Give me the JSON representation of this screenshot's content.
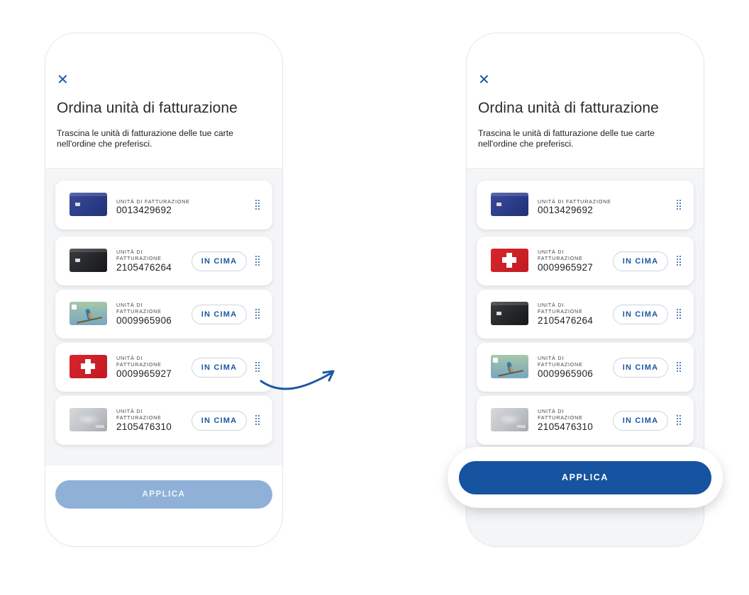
{
  "screen_before": {
    "close_label": "✕",
    "title": "Ordina unità di fatturazione",
    "subtitle": "Trascina le unità di fatturazione delle tue carte nell'ordine che preferisci.",
    "rows": [
      {
        "card": "blue",
        "label": "UNITÀ DI FATTURAZIONE",
        "number": "0013429692",
        "top_button": ""
      },
      {
        "card": "black",
        "label": "UNITÀ DI FATTURAZIONE",
        "number": "2105476264",
        "top_button": "IN CIMA"
      },
      {
        "card": "bird",
        "label": "UNITÀ DI FATTURAZIONE",
        "number": "0009965906",
        "top_button": "IN CIMA"
      },
      {
        "card": "swiss",
        "label": "UNITÀ DI FATTURAZIONE",
        "number": "0009965927",
        "top_button": "IN CIMA"
      },
      {
        "card": "silver",
        "label": "UNITÀ DI FATTURAZIONE",
        "number": "2105476310",
        "top_button": "IN CIMA"
      }
    ],
    "apply_label": "APPLICA",
    "apply_enabled": false
  },
  "screen_after": {
    "close_label": "✕",
    "title": "Ordina unità di fatturazione",
    "subtitle": "Trascina le unità di fatturazione delle tue carte nell'ordine che preferisci.",
    "rows": [
      {
        "card": "blue",
        "label": "UNITÀ DI FATTURAZIONE",
        "number": "0013429692",
        "top_button": ""
      },
      {
        "card": "swiss",
        "label": "UNITÀ DI FATTURAZIONE",
        "number": "0009965927",
        "top_button": "IN CIMA"
      },
      {
        "card": "black",
        "label": "UNITÀ DI FATTURAZIONE",
        "number": "2105476264",
        "top_button": "IN CIMA"
      },
      {
        "card": "bird",
        "label": "UNITÀ DI FATTURAZIONE",
        "number": "0009965906",
        "top_button": "IN CIMA"
      },
      {
        "card": "silver",
        "label": "UNITÀ DI FATTURAZIONE",
        "number": "2105476310",
        "top_button": "IN CIMA"
      }
    ],
    "apply_label": "APPLICA",
    "apply_enabled": true
  },
  "icons": {
    "close": "close-icon",
    "drag": "drag-handle-icon",
    "transition_arrow": "curved-arrow-right-icon"
  },
  "colors": {
    "accent": "#1b58a4",
    "apply_active": "#1653a0",
    "apply_disabled": "#8fb1d8"
  }
}
